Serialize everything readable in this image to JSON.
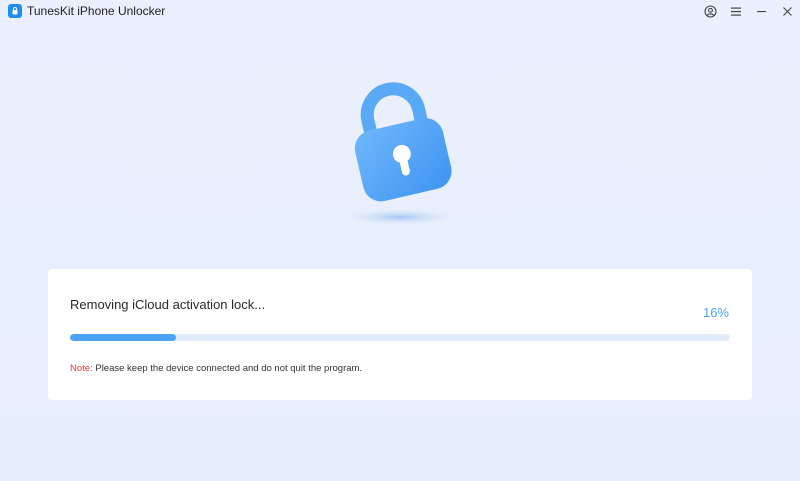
{
  "window": {
    "title": "TunesKit iPhone Unlocker",
    "controls": {
      "account_icon": "account-icon",
      "menu_icon": "menu-icon",
      "minimize_icon": "minimize-icon",
      "close_icon": "close-icon"
    }
  },
  "illustration": {
    "icon": "padlock-icon",
    "color": "#4aa3f5"
  },
  "progress": {
    "status_text": "Removing iCloud activation lock...",
    "percent_text": "16%",
    "value": 0.16,
    "bar_color": "#4aa3f5",
    "note_label": "Note:",
    "note_text": " Please keep the device connected and do not quit the program."
  }
}
